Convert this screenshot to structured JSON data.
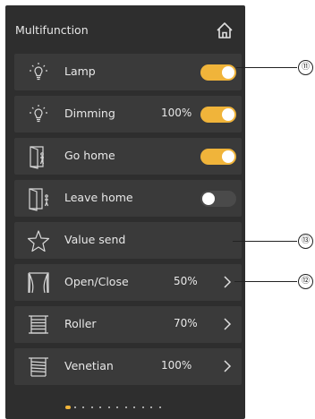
{
  "header": {
    "title": "Multifunction",
    "home_icon": "home-icon"
  },
  "rows": [
    {
      "icon": "lamp-icon",
      "label": "Lamp",
      "value": "",
      "control": "toggle",
      "state": "on"
    },
    {
      "icon": "lamp-icon",
      "label": "Dimming",
      "value": "100%",
      "control": "toggle",
      "state": "on"
    },
    {
      "icon": "door-enter-icon",
      "label": "Go home",
      "value": "",
      "control": "toggle",
      "state": "on"
    },
    {
      "icon": "door-leave-icon",
      "label": "Leave home",
      "value": "",
      "control": "toggle",
      "state": "off"
    },
    {
      "icon": "star-icon",
      "label": "Value send",
      "value": "",
      "control": "none"
    },
    {
      "icon": "curtain-icon",
      "label": "Open/Close",
      "value": "50%",
      "control": "chevron"
    },
    {
      "icon": "roller-icon",
      "label": "Roller",
      "value": "70%",
      "control": "chevron"
    },
    {
      "icon": "venetian-icon",
      "label": "Venetian",
      "value": "100%",
      "control": "chevron"
    }
  ],
  "pager": {
    "pages": 12,
    "active": 0
  },
  "callouts": [
    {
      "label": "⑪",
      "target": "Lamp toggle"
    },
    {
      "label": "⑬",
      "target": "Value send"
    },
    {
      "label": "⑫",
      "target": "Open/Close chevron"
    }
  ],
  "colors": {
    "accent": "#f0b43a",
    "panel": "#2e2e2e",
    "row": "#3a3a3a",
    "text": "#e8e8e8"
  }
}
